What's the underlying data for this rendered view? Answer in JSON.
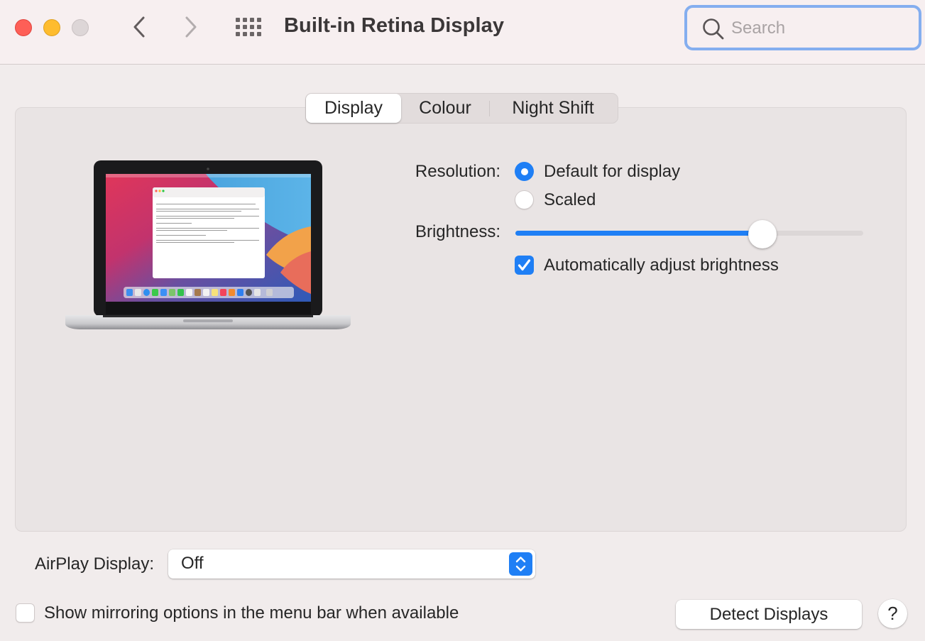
{
  "window": {
    "title": "Built-in Retina Display",
    "controls": [
      "close",
      "minimize",
      "zoom"
    ],
    "nav": {
      "back_icon": "chevron-left-icon",
      "forward_icon": "chevron-right-icon",
      "grid_icon": "show-all-grid-icon"
    }
  },
  "search": {
    "placeholder": "Search",
    "value": "",
    "icon": "magnifier-icon",
    "focused": true
  },
  "tabs": [
    {
      "label": "Display",
      "active": true
    },
    {
      "label": "Colour",
      "active": false
    },
    {
      "label": "Night Shift",
      "active": false
    }
  ],
  "display": {
    "illustration": "macbook-pro-preview",
    "resolution": {
      "label": "Resolution:",
      "options": [
        {
          "label": "Default for display",
          "selected": true
        },
        {
          "label": "Scaled",
          "selected": false
        }
      ]
    },
    "brightness": {
      "label": "Brightness:",
      "value": 0.71
    },
    "auto_brightness": {
      "label": "Automatically adjust brightness",
      "checked": true
    }
  },
  "airplay": {
    "label": "AirPlay Display:",
    "value": "Off"
  },
  "mirroring": {
    "label": "Show mirroring options in the menu bar when available",
    "checked": false
  },
  "buttons": {
    "detect": "Detect Displays",
    "help": "?"
  },
  "colors": {
    "accent": "#1f7ff5",
    "focus_ring": "#84aeef",
    "close": "#fe5f57",
    "minimize": "#febc2e"
  }
}
